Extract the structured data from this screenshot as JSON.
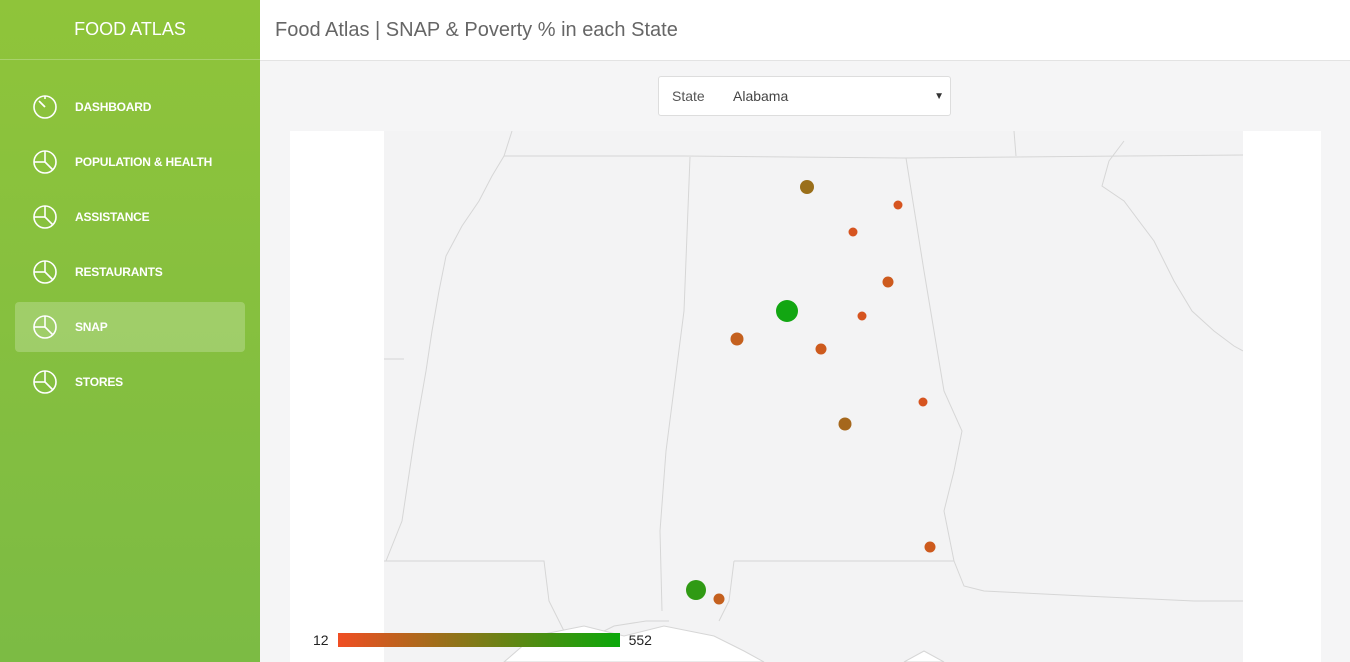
{
  "app": {
    "brand": "FOOD ATLAS"
  },
  "header": {
    "title": "Food Atlas | SNAP & Poverty % in each State"
  },
  "sidebar": {
    "items": [
      {
        "label": "DASHBOARD",
        "icon": "gauge-icon",
        "active": false
      },
      {
        "label": "POPULATION & HEALTH",
        "icon": "pie-chart-icon",
        "active": false
      },
      {
        "label": "ASSISTANCE",
        "icon": "pie-chart-icon",
        "active": false
      },
      {
        "label": "RESTAURANTS",
        "icon": "pie-chart-icon",
        "active": false
      },
      {
        "label": "SNAP",
        "icon": "pie-chart-icon",
        "active": true
      },
      {
        "label": "STORES",
        "icon": "pie-chart-icon",
        "active": false
      }
    ]
  },
  "state_selector": {
    "label": "State",
    "value": "Alabama"
  },
  "legend": {
    "min": "12",
    "max": "552",
    "color_low": "#f04e23",
    "color_high": "#0aa80a"
  },
  "colors": {
    "sidebar": "#8dc63f",
    "map_land": "#f3f3f4",
    "map_border": "#d4d4d4"
  }
}
